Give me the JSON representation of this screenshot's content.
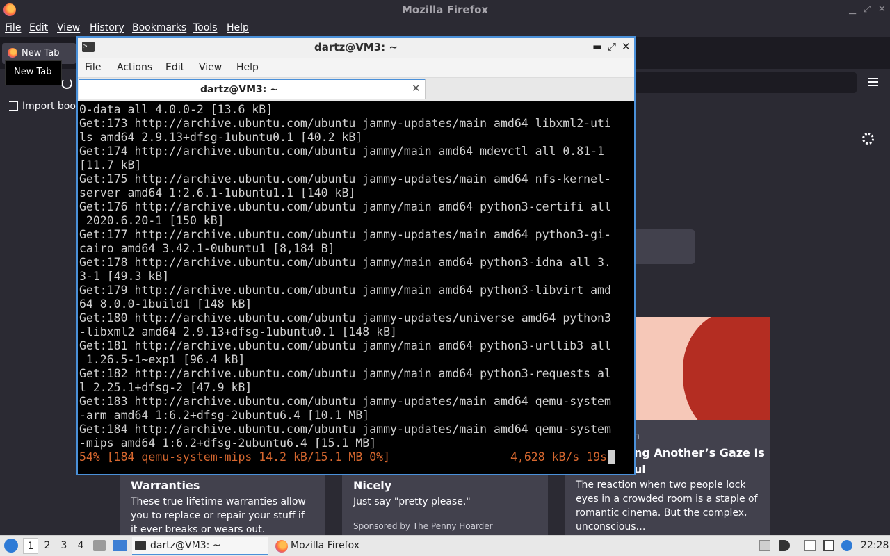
{
  "firefox": {
    "window_title": "Mozilla Firefox",
    "menu": [
      "File",
      "Edit",
      "View",
      "History",
      "Bookmarks",
      "Tools",
      "Help"
    ],
    "tab_label": "New Tab",
    "tooltip": "New Tab",
    "import_bookmarks": "Import book",
    "cards": [
      {
        "title": "Warranties",
        "text": "These true lifetime warranties allow you to replace or repair your stuff if it ever breaks or wears out."
      },
      {
        "title": "Nicely",
        "text": "Just say \"pretty please.\"",
        "sponsor": "Sponsored by The Penny Hoarder"
      }
    ],
    "story": {
      "source": "n",
      "title": "ng Another’s Gaze Is ul",
      "excerpt": "The reaction when two people lock eyes in a crowded room is a staple of romantic cinema. But the complex, unconscious…"
    }
  },
  "terminal": {
    "window_title": "dartz@VM3: ~",
    "menu": [
      "File",
      "Actions",
      "Edit",
      "View",
      "Help"
    ],
    "tab_label": "dartz@VM3: ~",
    "lines": [
      "0-data all 4.0.0-2 [13.6 kB]",
      "Get:173 http://archive.ubuntu.com/ubuntu jammy-updates/main amd64 libxml2-uti",
      "ls amd64 2.9.13+dfsg-1ubuntu0.1 [40.2 kB]",
      "Get:174 http://archive.ubuntu.com/ubuntu jammy/main amd64 mdevctl all 0.81-1",
      "[11.7 kB]",
      "Get:175 http://archive.ubuntu.com/ubuntu jammy-updates/main amd64 nfs-kernel-",
      "server amd64 1:2.6.1-1ubuntu1.1 [140 kB]",
      "Get:176 http://archive.ubuntu.com/ubuntu jammy/main amd64 python3-certifi all",
      " 2020.6.20-1 [150 kB]",
      "Get:177 http://archive.ubuntu.com/ubuntu jammy-updates/main amd64 python3-gi-",
      "cairo amd64 3.42.1-0ubuntu1 [8,184 B]",
      "Get:178 http://archive.ubuntu.com/ubuntu jammy/main amd64 python3-idna all 3.",
      "3-1 [49.3 kB]",
      "Get:179 http://archive.ubuntu.com/ubuntu jammy/main amd64 python3-libvirt amd",
      "64 8.0.0-1build1 [148 kB]",
      "Get:180 http://archive.ubuntu.com/ubuntu jammy-updates/universe amd64 python3",
      "-libxml2 amd64 2.9.13+dfsg-1ubuntu0.1 [148 kB]",
      "Get:181 http://archive.ubuntu.com/ubuntu jammy/main amd64 python3-urllib3 all",
      " 1.26.5-1~exp1 [96.4 kB]",
      "Get:182 http://archive.ubuntu.com/ubuntu jammy/main amd64 python3-requests al",
      "l 2.25.1+dfsg-2 [47.9 kB]",
      "Get:183 http://archive.ubuntu.com/ubuntu jammy-updates/main amd64 qemu-system",
      "-arm amd64 1:6.2+dfsg-2ubuntu6.4 [10.1 MB]",
      "Get:184 http://archive.ubuntu.com/ubuntu jammy-updates/main amd64 qemu-system",
      "-mips amd64 1:6.2+dfsg-2ubuntu6.4 [15.1 MB]"
    ],
    "progress_left": "54% [184 qemu-system-mips 14.2 kB/15.1 MB 0%]",
    "progress_right": "4,628 kB/s 19s",
    "colors": {
      "progress": "#d6672f",
      "accent": "#4a90d9"
    }
  },
  "taskbar": {
    "workspaces": [
      "1",
      "2",
      "3",
      "4"
    ],
    "tasks": [
      "dartz@VM3: ~",
      "Mozilla Firefox"
    ],
    "clock": "22:28"
  }
}
